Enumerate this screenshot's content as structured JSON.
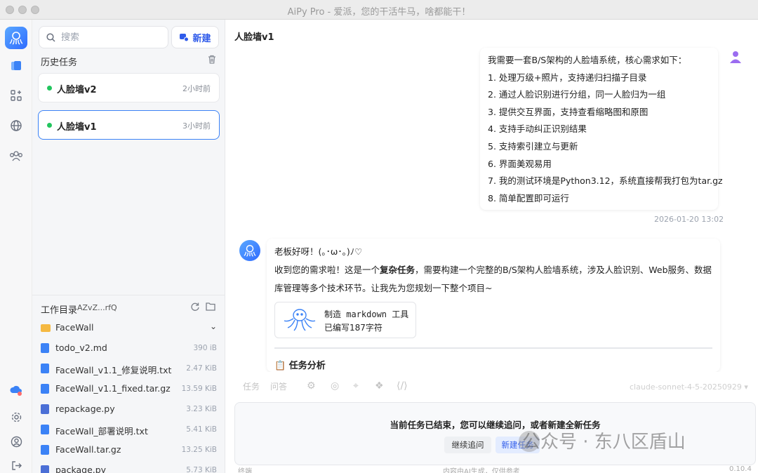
{
  "window": {
    "title": "AiPy Pro - 爱派，您的干活牛马，啥都能干！"
  },
  "sidebar": {
    "search_placeholder": "搜索",
    "new_label": "新建",
    "history_title": "历史任务",
    "tasks": [
      {
        "name": "人脸墙v2",
        "time": "2小时前"
      },
      {
        "name": "人脸墙v1",
        "time": "3小时前"
      }
    ],
    "workdir_label": "工作目录",
    "workdir_id": "AZvZ...rfQ",
    "files": [
      {
        "name": "FaceWall",
        "size": "",
        "type": "folder"
      },
      {
        "name": "todo_v2.md",
        "size": "390 iB",
        "type": "doc"
      },
      {
        "name": "FaceWall_v1.1_修复说明.txt",
        "size": "2.47 KiB",
        "type": "doc"
      },
      {
        "name": "FaceWall_v1.1_fixed.tar.gz",
        "size": "13.59 KiB",
        "type": "doc"
      },
      {
        "name": "repackage.py",
        "size": "3.23 KiB",
        "type": "py"
      },
      {
        "name": "FaceWall_部署说明.txt",
        "size": "5.41 KiB",
        "type": "doc"
      },
      {
        "name": "FaceWall.tar.gz",
        "size": "13.25 KiB",
        "type": "doc"
      },
      {
        "name": "package.py",
        "size": "5.73 KiB",
        "type": "py"
      }
    ]
  },
  "main": {
    "title": "人脸墙v1",
    "user_message": [
      "我需要一套B/S架构的人脸墙系统，核心需求如下：",
      "1. 处理万级+照片，支持递归扫描子目录",
      "2. 通过人脸识别进行分组，同一人脸归为一组",
      "3. 提供交互界面，支持查看缩略图和原图",
      "4. 支持手动纠正识别结果",
      "5. 支持索引建立与更新",
      "6. 界面美观易用",
      "7. 我的测试环境是Python3.12，系统直接帮我打包为tar.gz",
      "8. 简单配置即可运行"
    ],
    "user_message_time": "2026-01-20 13:02",
    "bot_greeting": "老板好呀！(｡･ω･｡)ﾉ♡",
    "bot_line_a": "收到您的需求啦！这是一个",
    "bot_line_bold": "复杂任务",
    "bot_line_b": "，需要构建一个完整的B/S架构人脸墙系统，涉及人脸识别、Web服务、数据",
    "bot_line_c": "库管理等多个技术环节。让我先为您规划一下整个项目~",
    "tool_card_title": "制造 markdown 工具",
    "tool_card_sub": "已编写187字符",
    "analysis_heading": "任务分析",
    "analysis_icon": "📋"
  },
  "bottom": {
    "tab_task": "任务",
    "tab_qa": "问答",
    "model": "claude-sonnet-4-5-20250929 ▾",
    "ended_message": "当前任务已结束，您可以继续追问，或者新建全新任务",
    "continue_label": "继续追问",
    "new_task_label": "新建任务",
    "footer_left": "终端",
    "footer_mid": "内容由AI生成，仅供参考",
    "footer_right": "0.10.4"
  },
  "watermark": "公众号 · 东八区盾山"
}
